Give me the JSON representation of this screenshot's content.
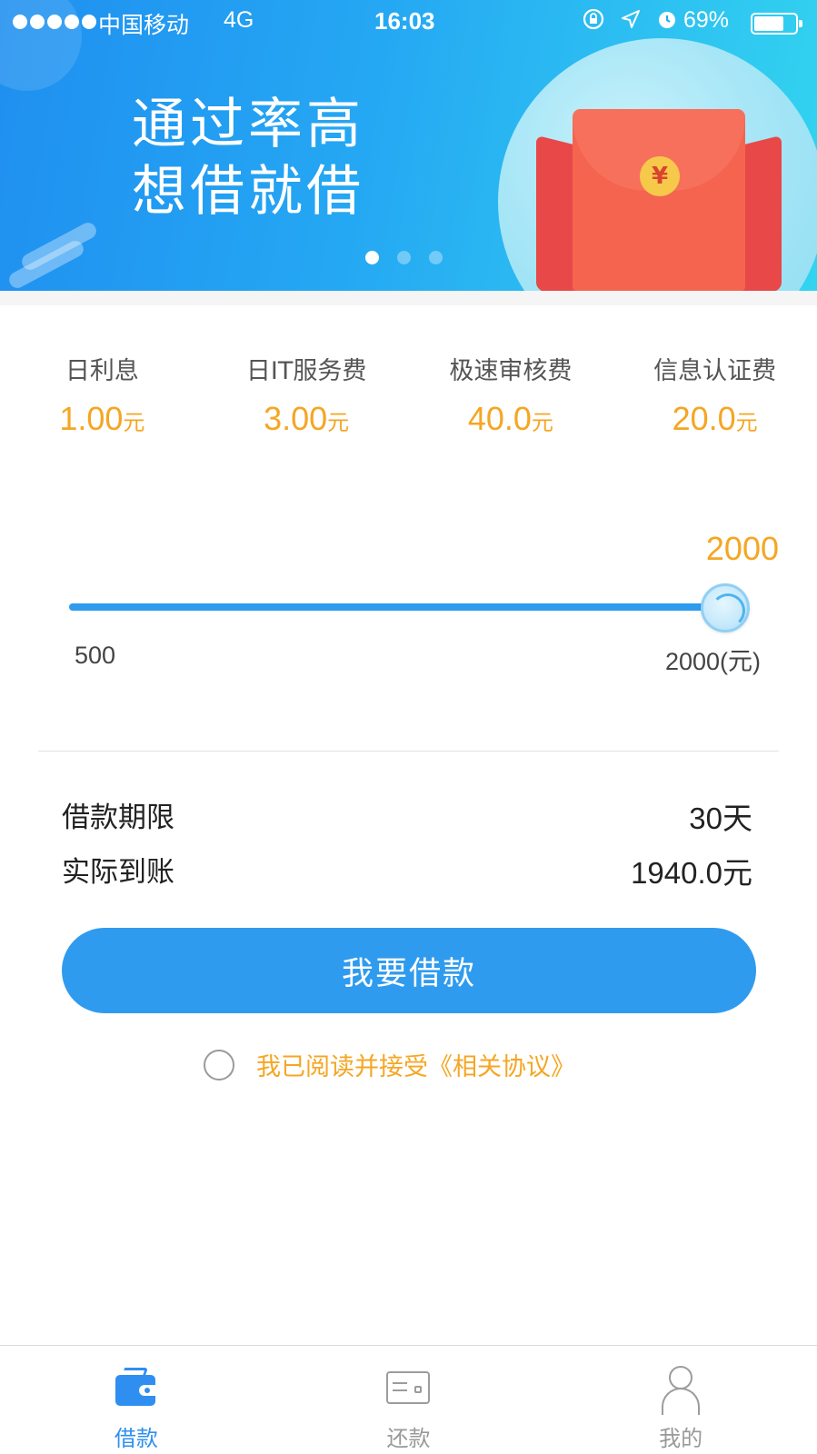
{
  "status_bar": {
    "carrier": "中国移动",
    "network": "4G",
    "time": "16:03",
    "battery": "69%",
    "icons": [
      "orientation-lock-icon",
      "location-icon",
      "alarm-icon",
      "battery-icon"
    ]
  },
  "banner": {
    "line1": "通过率高",
    "line2": "想借就借",
    "coin_symbol": "¥",
    "page_count": 3,
    "active_page": 1
  },
  "fees": [
    {
      "label": "日利息",
      "value": "1.00",
      "unit": "元"
    },
    {
      "label": "日IT服务费",
      "value": "3.00",
      "unit": "元"
    },
    {
      "label": "极速审核费",
      "value": "40.0",
      "unit": "元"
    },
    {
      "label": "信息认证费",
      "value": "20.0",
      "unit": "元"
    }
  ],
  "slider": {
    "current_amount": "2000",
    "min_label": "500",
    "max_label": "2000(元)",
    "min": 500,
    "max": 2000,
    "value": 2000
  },
  "details": {
    "term_label": "借款期限",
    "term_value": "30天",
    "actual_label": "实际到账",
    "actual_value": "1940.0元"
  },
  "borrow_button": "我要借款",
  "agreement": "我已阅读并接受《相关协议》",
  "tabs": [
    {
      "label": "借款",
      "icon": "wallet-icon",
      "active": true
    },
    {
      "label": "还款",
      "icon": "card-icon",
      "active": false
    },
    {
      "label": "我的",
      "icon": "user-icon",
      "active": false
    }
  ],
  "colors": {
    "primary": "#2f9bef",
    "accent": "#f5a623",
    "tab_active": "#2f8ff0",
    "tab_inactive": "#999999"
  }
}
